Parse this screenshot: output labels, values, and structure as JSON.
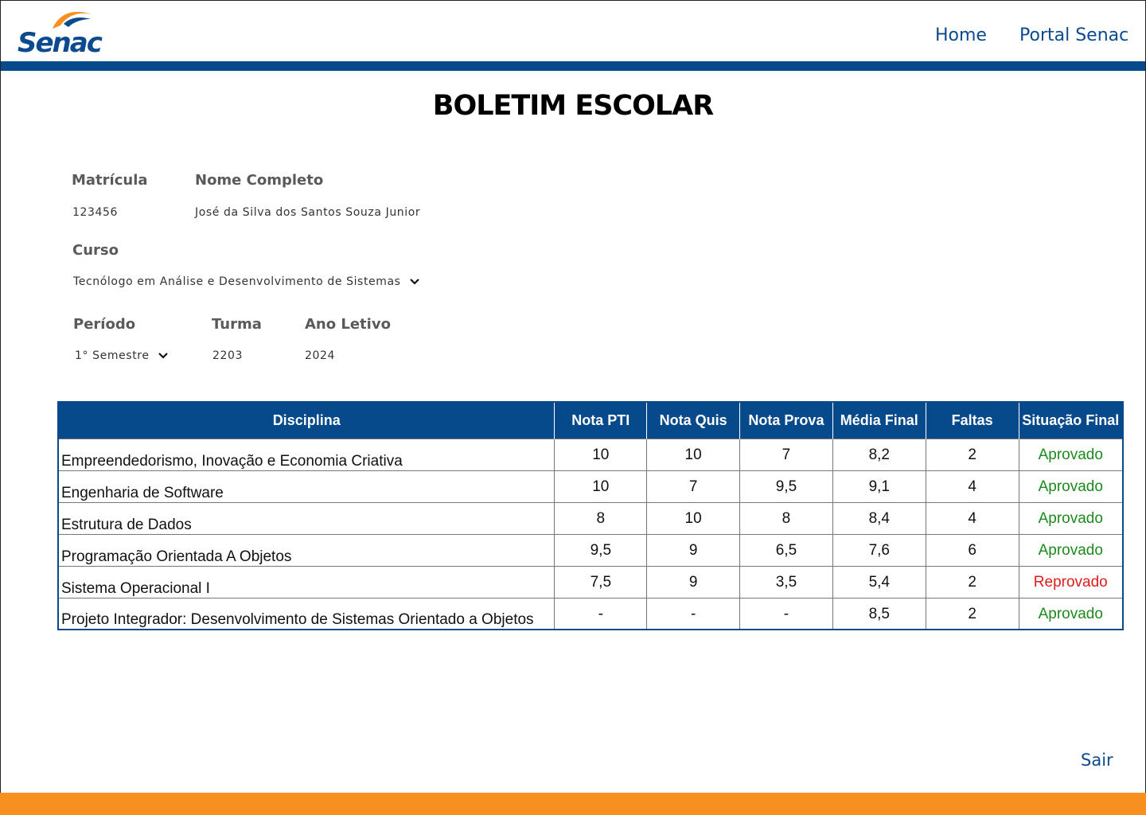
{
  "header": {
    "logo_text": "Senac",
    "nav": {
      "home": "Home",
      "portal": "Portal Senac"
    }
  },
  "title": "BOLETIM ESCOLAR",
  "student": {
    "matricula_label": "Matrícula",
    "matricula": "123456",
    "nome_label": "Nome Completo",
    "nome": "José da Silva dos Santos Souza Junior",
    "curso_label": "Curso",
    "curso": "Tecnólogo em Análise e Desenvolvimento de Sistemas",
    "periodo_label": "Período",
    "periodo": "1° Semestre",
    "turma_label": "Turma",
    "turma": "2203",
    "ano_label": "Ano Letivo",
    "ano": "2024"
  },
  "table": {
    "headers": [
      "Disciplina",
      "Nota PTI",
      "Nota Quis",
      "Nota Prova",
      "Média Final",
      "Faltas",
      "Situação Final"
    ],
    "rows": [
      [
        "Empreendedorismo, Inovação e Economia Criativa",
        "10",
        "10",
        "7",
        "8,2",
        "2",
        "Aprovado"
      ],
      [
        "Engenharia de Software",
        "10",
        "7",
        "9,5",
        "9,1",
        "4",
        "Aprovado"
      ],
      [
        "Estrutura de Dados",
        "8",
        "10",
        "8",
        "8,4",
        "4",
        "Aprovado"
      ],
      [
        "Programação Orientada A Objetos",
        "9,5",
        "9",
        "6,5",
        "7,6",
        "6",
        "Aprovado"
      ],
      [
        "Sistema Operacional I",
        "7,5",
        "9",
        "3,5",
        "5,4",
        "2",
        "Reprovado"
      ],
      [
        "Projeto Integrador: Desenvolvimento de Sistemas Orientado a Objetos",
        "-",
        "-",
        "-",
        "8,5",
        "2",
        "Aprovado"
      ]
    ]
  },
  "footer": {
    "logout": "Sair"
  },
  "colors": {
    "primary": "#064a8c",
    "accent": "#f7901e",
    "approved": "#1c8a1c",
    "failed": "#e01b1b"
  }
}
